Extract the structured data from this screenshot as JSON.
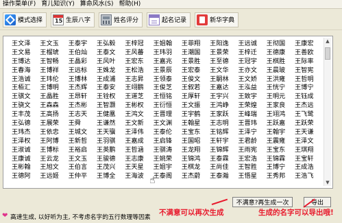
{
  "menubar": [
    "操作菜单(F)",
    "育儿知识(Y)",
    "算命风水(S)",
    "帮助(H)"
  ],
  "toolbar": [
    {
      "label": "模式选择",
      "icon": "mode-icon"
    },
    {
      "label": "生辰八字",
      "icon": "calendar-icon",
      "badge": "15"
    },
    {
      "label": "姓名评分",
      "icon": "score-icon"
    },
    {
      "label": "起名记录",
      "icon": "record-icon"
    },
    {
      "label": "新华字典",
      "icon": "dictionary-icon"
    }
  ],
  "names": [
    [
      "王文泽",
      "王文玉",
      "王泰宇",
      "王弘毅",
      "王梓冠",
      "王姐翰",
      "王菲翔",
      "王阳逸",
      "王远诚",
      "王彻国",
      "王康宏",
      "王云悠",
      "王彬翔",
      "王文栋"
    ],
    [
      "王文易",
      "王榴琥",
      "王伯灿",
      "王泰文",
      "王风蕃",
      "王玮羽",
      "王潮国",
      "王景荣",
      "王梓迁",
      "王德康",
      "王善欧",
      "王贵博",
      "王泽仁",
      "王文琪"
    ],
    [
      "王博达",
      "王智畅",
      "王晶彩",
      "王风叶",
      "王宏东",
      "王嘉兆",
      "王景胜",
      "王至德",
      "王冠宇",
      "王棋胜",
      "王际率",
      "王庆云",
      "王宣卓",
      "王冠益"
    ],
    [
      "王春海",
      "王博祥",
      "王远标",
      "王姝龙",
      "王松浩",
      "王景辰",
      "王宏泰",
      "王文华",
      "王亦文",
      "王晨玻",
      "王智宪",
      "王翰思",
      "王纹福",
      "王世军"
    ],
    [
      "王浩诚",
      "王玮伦",
      "王博林",
      "王成浦",
      "王志昇",
      "王领泰",
      "王俊文",
      "王嗣林",
      "王文娇",
      "王洪雍",
      "王哲明",
      "王远宫",
      "王翊昂",
      "王晨运"
    ],
    [
      "王栢汇",
      "王博明",
      "王杰辉",
      "王泰安",
      "王翊鹏",
      "王俊芝",
      "王叙若",
      "王嘉达",
      "王泓益",
      "王恍宁",
      "王博宁",
      "王欣宠",
      "王泰源",
      "王钰新"
    ],
    [
      "王骐文",
      "王晶胜",
      "王昂轩",
      "王铨权",
      "王道芝",
      "王恒铭",
      "王厚轩",
      "王宇兴",
      "王致宇",
      "王明元",
      "王钰成",
      "王鸥瀚",
      "王鸥嘉",
      "王文宝"
    ],
    [
      "王骁文",
      "王森森",
      "王杰彬",
      "王智灏",
      "王彬权",
      "王衍恒",
      "王文振",
      "王鸿峥",
      "王荣煌",
      "王家良",
      "王杰远",
      "王远苍",
      "王健玮",
      "王玮煌"
    ],
    [
      "王丰茂",
      "王高扬",
      "王志天",
      "王健凰",
      "王鸿文",
      "王晋理",
      "王宇鹤",
      "王家跃",
      "王峰瑞",
      "王翊鸿",
      "王飞鹭",
      "王栢凯",
      "王宇歌",
      "王骁鹏"
    ],
    [
      "王弘德",
      "王展荣",
      "王舜",
      "王谦然",
      "王文新",
      "王文渊",
      "王翰星",
      "王志明",
      "王晋玮",
      "王跃嘉",
      "王跃荣",
      "王棋宇",
      "王文量",
      "王沙欢"
    ],
    [
      "王玮杰",
      "王依忠",
      "王城文",
      "王天骥",
      "王泽伟",
      "王泰伦",
      "王宝东",
      "王铭辉",
      "王泽宁",
      "王翰宇",
      "王天谦",
      "王万波",
      "王晃军",
      "王稿博"
    ],
    [
      "王泽权",
      "王阿博",
      "王新哲",
      "王羽骐",
      "王嘉成",
      "王启锋",
      "王国昭",
      "王轩宇",
      "王君龄",
      "王震雍",
      "王泽文",
      "王嘉彬",
      "王丰俊",
      "王哲峰"
    ],
    [
      "王淑诚",
      "王博标",
      "王裕启",
      "王英鹏",
      "王哲涵",
      "王骐涛",
      "王龙翔",
      "王锦辉",
      "王雨宪",
      "王宝东",
      "王琪翔",
      "王博峰",
      "王博苑",
      "王浩冠"
    ],
    [
      "王康诚",
      "王云龙",
      "王文玉",
      "王骏德",
      "王志康",
      "王姚荣",
      "王锦鸿",
      "王泰霖",
      "王宏浩",
      "王锦霖",
      "王宝轩",
      "王文翰",
      "王泽凯",
      "王宣康"
    ],
    [
      "王彬翰",
      "王旭文",
      "王伯言",
      "王茂兴",
      "王天星",
      "王姐宇",
      "王棋龙",
      "王尚佳",
      "王智胜",
      "王博宁",
      "王成浩",
      "王佳琦",
      "王晓翰",
      "王宣太"
    ],
    [
      "王德阿",
      "王远姬",
      "王仲平",
      "王博全",
      "王海波",
      "王泰阁",
      "王杰蔚",
      "王泰瀚",
      "王悟星",
      "王秀邦",
      "王浩飞",
      "王成泰",
      "王飞豪",
      "王圣怡"
    ]
  ],
  "buttons": {
    "regenerate": "不满意?再生成一次",
    "export": "导出"
  },
  "annotations": {
    "regenerate_hint": "不满意可以再次生成",
    "export_hint": "生成的名字可以导出哦!"
  },
  "status": "高速生成, 以好听为主, 不考虑名字的五行数理等因素",
  "colors": {
    "annotation_red": "#e8192c"
  }
}
